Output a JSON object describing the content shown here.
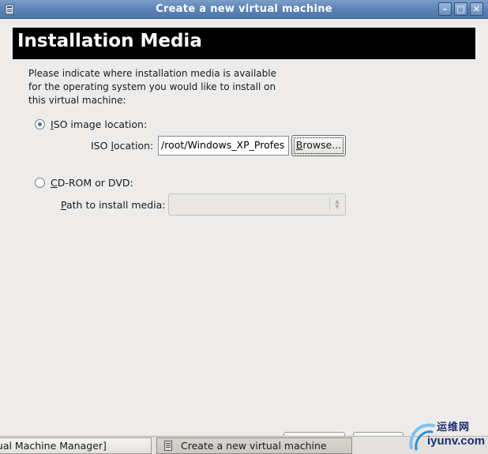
{
  "window": {
    "title": "Create a new virtual machine",
    "buttons": {
      "minimize": "–",
      "maximize": "□",
      "close": "✕"
    }
  },
  "page": {
    "heading": "Installation Media",
    "description": "Please indicate where installation media is available for the operating system you would like to install on this virtual machine:"
  },
  "iso_option": {
    "label_prefix": "",
    "label_mnemonic": "I",
    "label_rest": "SO image location:",
    "checked": true,
    "location_label_prefix": "ISO ",
    "location_label_mnemonic": "l",
    "location_label_rest": "ocation:",
    "location_value": "/root/Windows_XP_Profes",
    "browse_mnemonic": "B",
    "browse_rest": "rowse..."
  },
  "cdrom_option": {
    "label_mnemonic": "C",
    "label_rest": "D-ROM or DVD:",
    "checked": false,
    "path_label_mnemonic": "P",
    "path_label_rest": "ath to install media:",
    "path_value": ""
  },
  "taskbar": {
    "items": [
      {
        "label": "tual Machine Manager]"
      },
      {
        "label": "Create a new virtual machine"
      }
    ]
  },
  "watermark": {
    "cn": "运维网",
    "en": "iyunv.com"
  },
  "colors": {
    "titlebar": "#5f86b8",
    "banner": "#000000",
    "banner_text": "#ffffff",
    "window_bg": "#edeceb"
  }
}
